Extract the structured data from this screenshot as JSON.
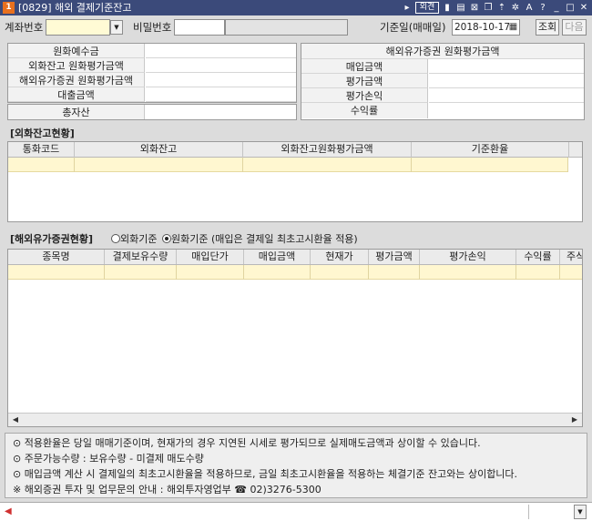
{
  "window": {
    "app_badge": "1",
    "title": "[0829] 해외 결제기준잔고",
    "toolbar_badge": "외견",
    "icons": [
      "pin-icon",
      "clipboard-icon",
      "mail-icon",
      "copy-icon",
      "up-icon",
      "settings-icon",
      "font-icon",
      "help-icon",
      "minimize-icon",
      "restore-icon",
      "close-icon"
    ]
  },
  "query": {
    "account_label": "계좌번호",
    "account_value": "",
    "password_label": "비밀번호",
    "password_value": "",
    "date_label": "기준일(매매일)",
    "date_value": "2018-10-17",
    "search_button": "조회",
    "next_button": "다음"
  },
  "summary_left": {
    "rows": [
      {
        "label": "원화예수금",
        "value": ""
      },
      {
        "label": "외화잔고 원화평가금액",
        "value": ""
      },
      {
        "label": "해외유가증권 원화평가금액",
        "value": ""
      },
      {
        "label": "대출금액",
        "value": ""
      }
    ],
    "total_label": "총자산",
    "total_value": ""
  },
  "summary_right": {
    "header": "해외유가증권 원화평가금액",
    "rows": [
      {
        "label": "매입금액",
        "value": ""
      },
      {
        "label": "평가금액",
        "value": ""
      },
      {
        "label": "평가손익",
        "value": ""
      },
      {
        "label": "수익률",
        "value": ""
      }
    ]
  },
  "fx_section": {
    "title": "[외화잔고현황]",
    "columns": [
      "통화코드",
      "외화잔고",
      "외화잔고원화평가금액",
      "기준환율"
    ]
  },
  "sec_section": {
    "title": "[해외유가증권현황]",
    "radio_fx": "외화기준",
    "radio_krw": "원화기준",
    "radio_note": "(매입은 결제일 최초고시환율 적용)",
    "selected": "krw",
    "columns": [
      "종목명",
      "결제보유수량",
      "매입단가",
      "매입금액",
      "현재가",
      "평가금액",
      "평가손익",
      "수익률",
      "주식"
    ]
  },
  "notes": [
    "⊙ 적용환율은 당일 매매기준이며, 현재가의 경우 지연된 시세로 평가되므로 실제매도금액과 상이할 수 있습니다.",
    "⊙ 주문가능수량 : 보유수량 - 미결제 매도수량",
    "⊙ 매입금액 계산 시 결제일의 최초고시환율을 적용하므로, 금일 최초고시환율을 적용하는 체결기준 잔고와는 상이합니다.",
    "※ 해외증권 투자 및 업무문의 안내 : 해외투자영업부 ☎ 02)3276-5300"
  ],
  "status": {
    "message": ""
  },
  "colors": {
    "titlebar": "#3b4a7a",
    "row_highlight": "#fff7d0",
    "input_yellow": "#fffbd5"
  }
}
